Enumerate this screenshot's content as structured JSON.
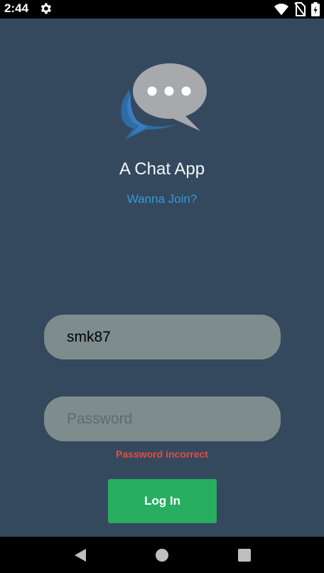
{
  "status_bar": {
    "time": "2:44"
  },
  "app": {
    "title": "A Chat App",
    "join_link": "Wanna Join?"
  },
  "login": {
    "username_value": "smk87",
    "password_placeholder": "Password",
    "error": "Password incorrect",
    "button_label": "Log In"
  },
  "colors": {
    "background": "#34495e",
    "field": "#7f8c8d",
    "accent_link": "#3498db",
    "error": "#e74c3c",
    "button": "#27ae60"
  },
  "icons": [
    "gear-icon",
    "wifi-icon",
    "no-sim-icon",
    "battery-icon",
    "chat-logo-icon",
    "back-icon",
    "home-icon",
    "recents-icon"
  ]
}
